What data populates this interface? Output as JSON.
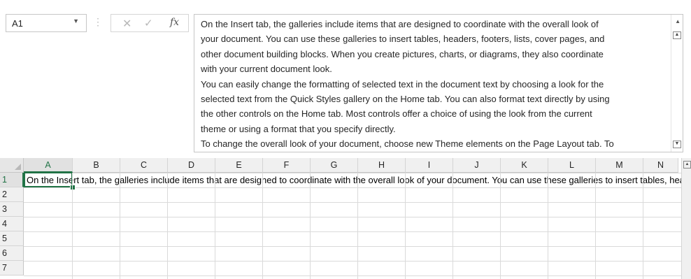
{
  "name_box": {
    "value": "A1",
    "dropdown_icon": "chevron-down-icon"
  },
  "formula_toolbar": {
    "separator_icon": "vertical-dots-icon",
    "cancel_icon": "close-icon",
    "enter_icon": "checkmark-icon",
    "function_label": "fx"
  },
  "formula_bar": {
    "lines": [
      "On the Insert tab, the galleries include items that are designed to coordinate with the overall look of",
      "your document. You can use these galleries to insert tables, headers, footers, lists, cover pages, and",
      "other document building blocks. When you create pictures, charts, or diagrams, they also coordinate",
      "with your current document look.",
      "You can easily change the formatting of selected text in the document text by choosing a look for the",
      "selected text from the Quick Styles gallery on the Home tab. You can also format text directly by using",
      "the other controls on the Home tab. Most controls offer a choice of using the look from the current",
      "theme or using a format that you specify directly.",
      "To change the overall look of your document, choose new Theme elements on the Page Layout tab. To"
    ]
  },
  "grid": {
    "columns": [
      "A",
      "B",
      "C",
      "D",
      "E",
      "F",
      "G",
      "H",
      "I",
      "J",
      "K",
      "L",
      "M",
      "N"
    ],
    "rows": [
      "1",
      "2",
      "3",
      "4",
      "5",
      "6",
      "7"
    ],
    "active_column": "A",
    "active_row": "1",
    "cell_a1": "On the Insert tab, the galleries include items that are designed to coordinate with the overall look of your document. You can use these galleries to insert tables, headers, footers, lists, cover pages, and other document building blocks."
  },
  "colors": {
    "accent": "#217346",
    "gridline": "#dadada",
    "header_bg": "#f0f0f0"
  }
}
